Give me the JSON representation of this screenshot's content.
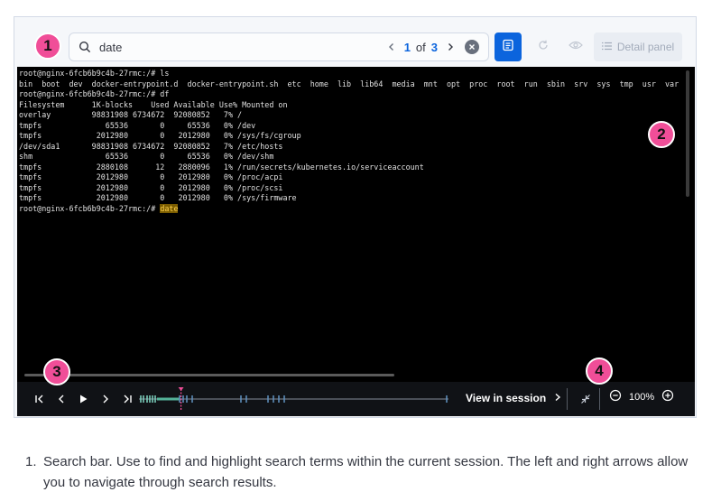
{
  "badges": [
    "1",
    "2",
    "3",
    "4"
  ],
  "search": {
    "value": "date",
    "current": "1",
    "of_label": "of",
    "total": "3"
  },
  "toolbar": {
    "detail_panel_label": "Detail panel",
    "accent_color": "#0b64dd"
  },
  "terminal": {
    "prompt": "root@nginx-6fcb6b9c4b-27rmc:/#",
    "lines": [
      "root@nginx-6fcb6b9c4b-27rmc:/# ls",
      "bin  boot  dev  docker-entrypoint.d  docker-entrypoint.sh  etc  home  lib  lib64  media  mnt  opt  proc  root  run  sbin  srv  sys  tmp  usr  var",
      "root@nginx-6fcb6b9c4b-27rmc:/# df",
      "Filesystem      1K-blocks    Used Available Use% Mounted on",
      "overlay         98831908 6734672  92080852   7% /",
      "tmpfs              65536       0     65536   0% /dev",
      "tmpfs            2012980       0   2012980   0% /sys/fs/cgroup",
      "/dev/sda1       98831908 6734672  92080852   7% /etc/hosts",
      "shm                65536       0     65536   0% /dev/shm",
      "tmpfs            2880108      12   2880096   1% /run/secrets/kubernetes.io/serviceaccount",
      "tmpfs            2012980       0   2012980   0% /proc/acpi",
      "tmpfs            2012980       0   2012980   0% /proc/scsi",
      "tmpfs            2012980       0   2012980   0% /sys/firmware"
    ],
    "last_command": "date"
  },
  "controls": {
    "view_in_session_label": "View in session",
    "zoom_level": "100%",
    "playback_progress": 0.13
  },
  "caption": {
    "number": "1.",
    "text": "Search bar. Use to find and highlight search terms within the current session. The left and right arrows allow you to navigate through search results."
  }
}
